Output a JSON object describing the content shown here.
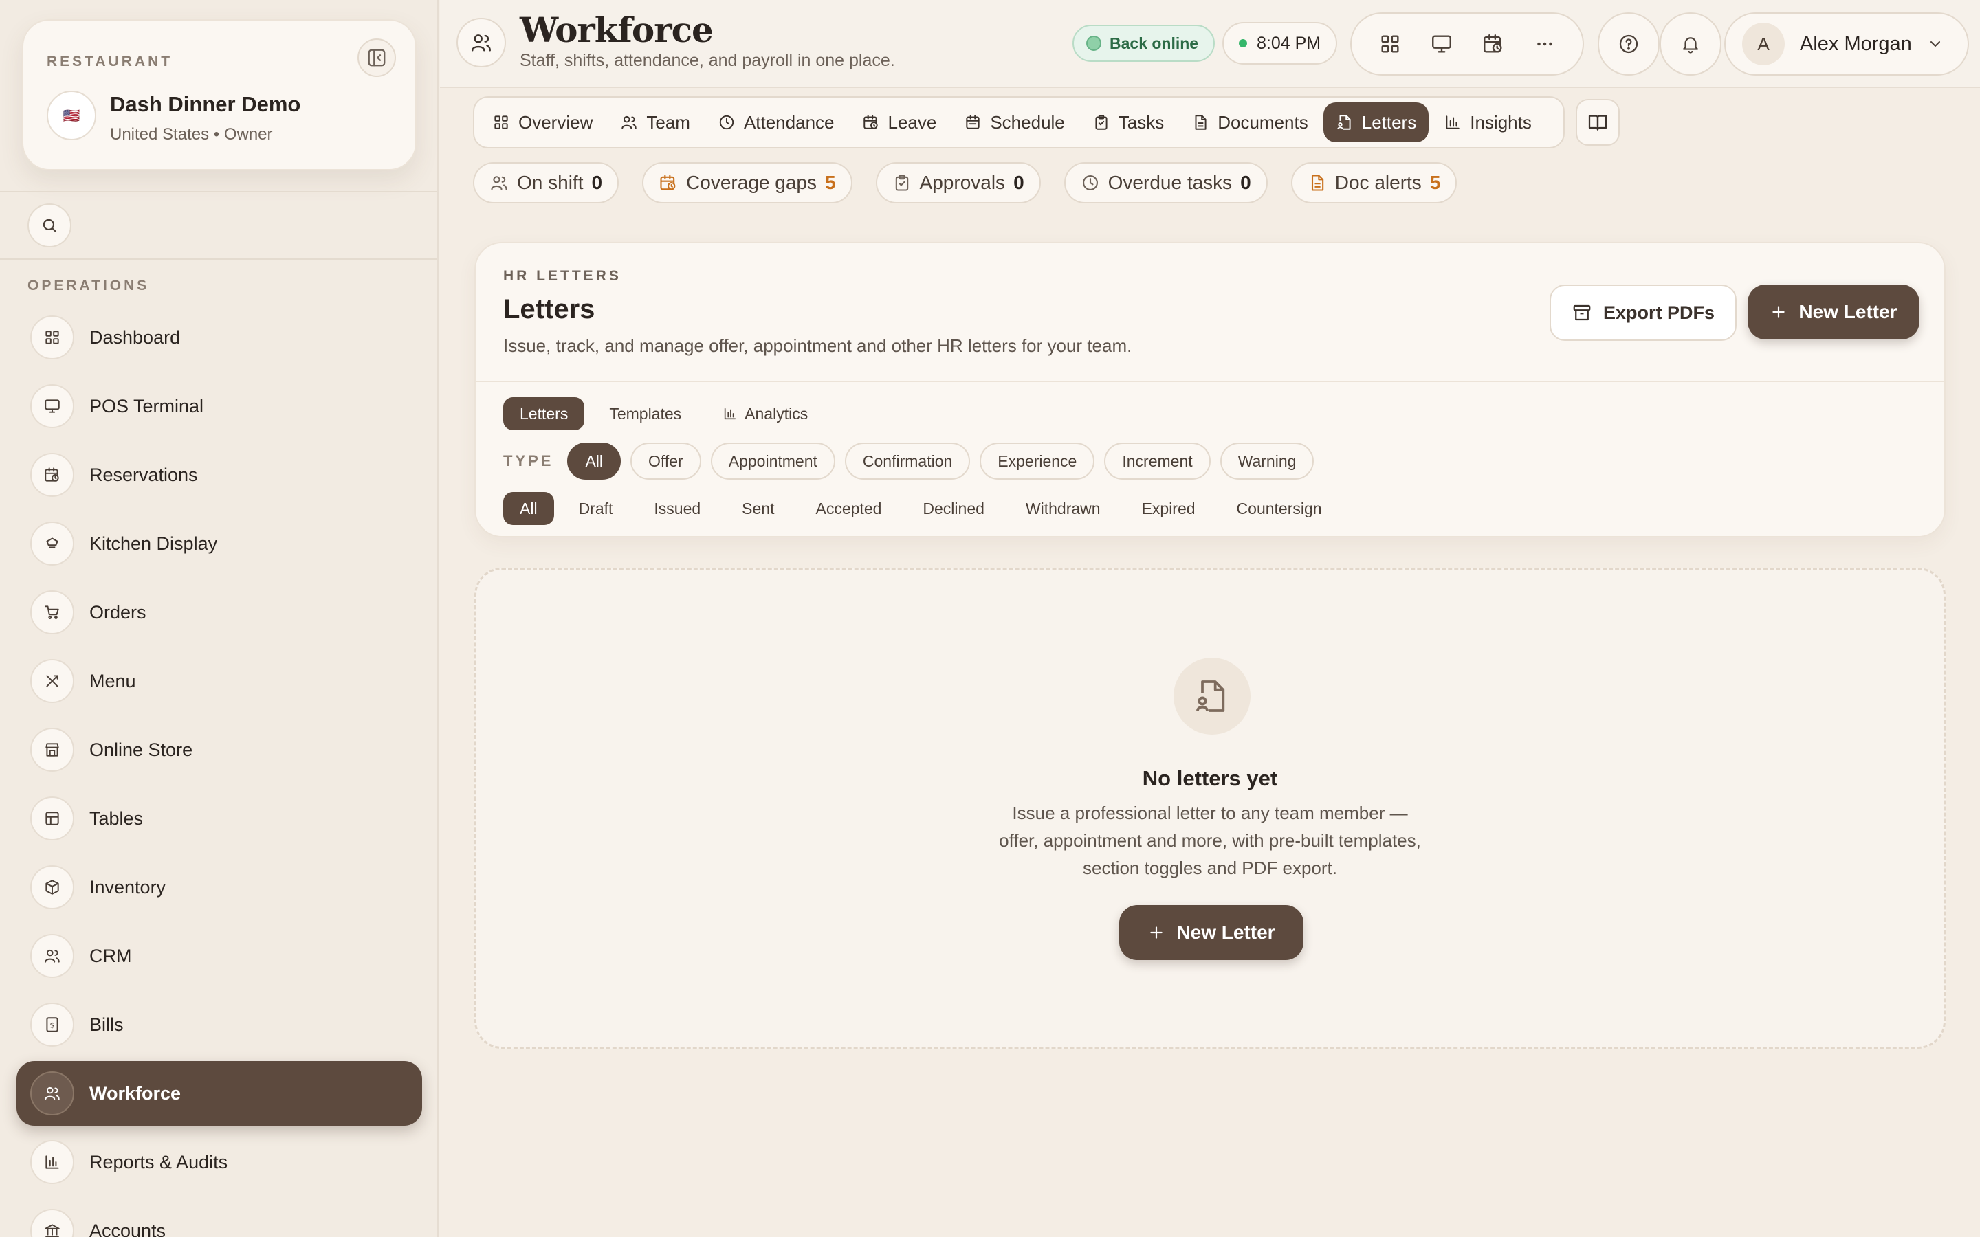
{
  "colors": {
    "accent": "#5d4a3e",
    "background": "#f4ede4",
    "card": "#fbf7f2",
    "online": "#2c6b46",
    "warning": "#c8701c"
  },
  "sidebar": {
    "kicker": "RESTAURANT",
    "restaurant_name": "Dash Dinner Demo",
    "flag": "🇺🇸",
    "restaurant_meta": "United States • Owner",
    "section_label": "OPERATIONS",
    "items": [
      {
        "label": "Dashboard",
        "icon": "grid-icon"
      },
      {
        "label": "POS Terminal",
        "icon": "monitor-icon"
      },
      {
        "label": "Reservations",
        "icon": "calendar-clock-icon"
      },
      {
        "label": "Kitchen Display",
        "icon": "chef-hat-icon"
      },
      {
        "label": "Orders",
        "icon": "cart-icon"
      },
      {
        "label": "Menu",
        "icon": "utensils-icon"
      },
      {
        "label": "Online Store",
        "icon": "store-icon"
      },
      {
        "label": "Tables",
        "icon": "table-icon"
      },
      {
        "label": "Inventory",
        "icon": "box-icon"
      },
      {
        "label": "CRM",
        "icon": "users-icon"
      },
      {
        "label": "Bills",
        "icon": "receipt-icon"
      },
      {
        "label": "Workforce",
        "icon": "users-icon",
        "active": true
      },
      {
        "label": "Reports & Audits",
        "icon": "bar-chart-icon"
      },
      {
        "label": "Accounts",
        "icon": "bank-icon"
      }
    ]
  },
  "header": {
    "title": "Workforce",
    "subtitle": "Staff, shifts, attendance, and payroll in one place.",
    "status": "Back online",
    "time": "8:04 PM",
    "user_initial": "A",
    "user_name": "Alex Morgan"
  },
  "tabs": [
    {
      "label": "Overview",
      "icon": "grid-icon"
    },
    {
      "label": "Team",
      "icon": "users-icon"
    },
    {
      "label": "Attendance",
      "icon": "clock-icon"
    },
    {
      "label": "Leave",
      "icon": "calendar-clock-icon"
    },
    {
      "label": "Schedule",
      "icon": "calendar-icon"
    },
    {
      "label": "Tasks",
      "icon": "clipboard-icon"
    },
    {
      "label": "Documents",
      "icon": "file-icon"
    },
    {
      "label": "Letters",
      "icon": "letter-icon",
      "active": true
    },
    {
      "label": "Insights",
      "icon": "bar-chart-icon"
    }
  ],
  "stats": [
    {
      "label": "On shift",
      "value": "0",
      "icon": "users-icon"
    },
    {
      "label": "Coverage gaps",
      "value": "5",
      "icon": "calendar-clock-icon",
      "warn": true
    },
    {
      "label": "Approvals",
      "value": "0",
      "icon": "clipboard-icon"
    },
    {
      "label": "Overdue tasks",
      "value": "0",
      "icon": "clock-icon"
    },
    {
      "label": "Doc alerts",
      "value": "5",
      "icon": "file-icon",
      "warn": true
    }
  ],
  "letters": {
    "kicker": "HR LETTERS",
    "title": "Letters",
    "description": "Issue, track, and manage offer, appointment and other HR letters for your team.",
    "export_label": "Export PDFs",
    "new_label": "New Letter",
    "subtabs": [
      "Letters",
      "Templates",
      "Analytics"
    ],
    "type_label": "TYPE",
    "types": [
      "All",
      "Offer",
      "Appointment",
      "Confirmation",
      "Experience",
      "Increment",
      "Warning"
    ],
    "statuses": [
      "All",
      "Draft",
      "Issued",
      "Sent",
      "Accepted",
      "Declined",
      "Withdrawn",
      "Expired",
      "Countersign"
    ]
  },
  "empty_state": {
    "title": "No letters yet",
    "description": "Issue a professional letter to any team member — offer, appointment and more, with pre-built templates, section toggles and PDF export.",
    "button_label": "New Letter"
  }
}
